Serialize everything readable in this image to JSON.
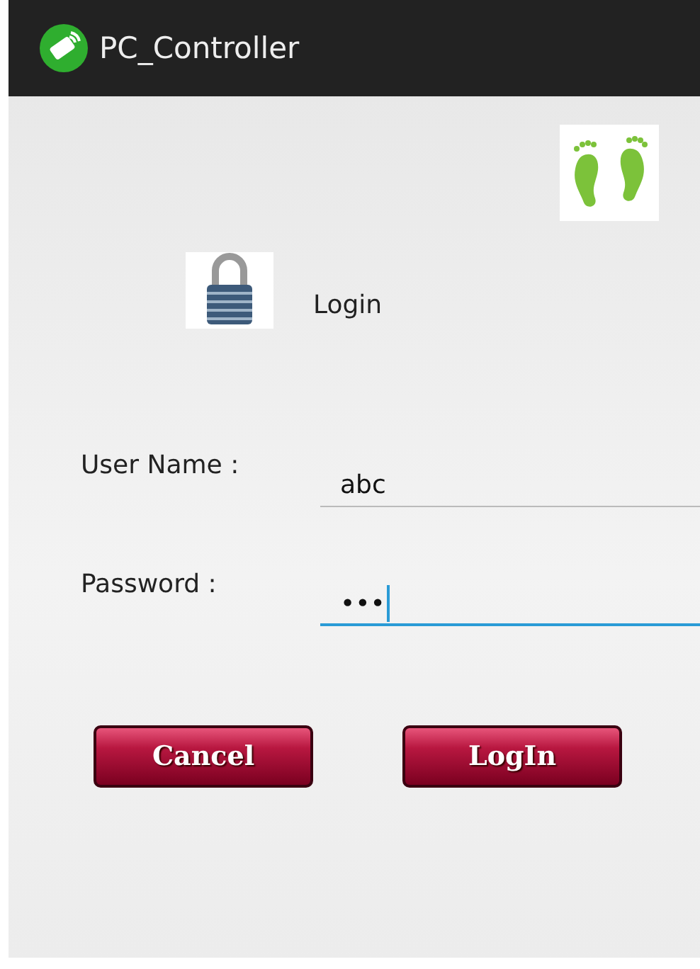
{
  "app_bar": {
    "title": "PC_Controller"
  },
  "header": {
    "title": "Login"
  },
  "fields": [
    {
      "label": "User Name :",
      "value": "abc",
      "focused": false
    },
    {
      "label": "Password :",
      "value": "•••",
      "focused": true
    }
  ],
  "buttons": [
    "Cancel",
    "LogIn"
  ]
}
